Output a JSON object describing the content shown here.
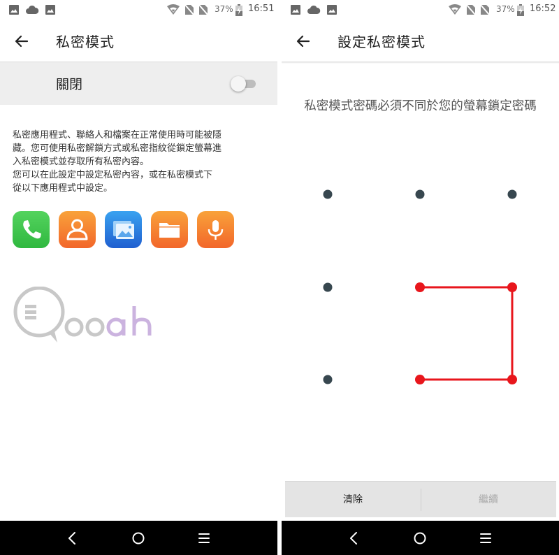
{
  "status_bar": {
    "battery": "37%",
    "time_left": "16:51",
    "time_right": "16:52"
  },
  "left_screen": {
    "title": "私密模式",
    "toggle": {
      "label": "關閉",
      "state": "off"
    },
    "description_lines": [
      "私密應用程式、聯絡人和檔案在正常使用時可能被隱",
      "藏。您可使用私密解鎖方式或私密指紋從鎖定螢幕進",
      "入私密模式並存取所有私密內容。",
      "您可以在此設定中設定私密內容，或在私密模式下",
      "從以下應用程式中設定。"
    ],
    "apps": [
      {
        "icon": "phone-icon",
        "color": "#3cc24b"
      },
      {
        "icon": "contacts-icon",
        "color": "#f5732a"
      },
      {
        "icon": "gallery-icon",
        "color": "#2f7fe0"
      },
      {
        "icon": "file-manager-icon",
        "color": "#f5732a"
      },
      {
        "icon": "sound-recorder-icon",
        "color": "#f5732a"
      }
    ],
    "watermark": "Qooah"
  },
  "right_screen": {
    "title": "設定私密模式",
    "hint": "私密模式密碼必須不同於您的螢幕鎖定密碼",
    "pattern": {
      "grid": [
        [
          1,
          2,
          3
        ],
        [
          4,
          5,
          6
        ],
        [
          7,
          8,
          9
        ]
      ],
      "selected_sequence": [
        5,
        6,
        9,
        8
      ],
      "line_color": "#e8161c",
      "dot_color": "#37474f"
    },
    "clear_button": "清除",
    "continue_button": "繼續"
  },
  "colors": {
    "accent_red": "#e8161c",
    "toggle_row_bg": "#eeeeee",
    "action_bar_bg": "#e4e4e4"
  }
}
